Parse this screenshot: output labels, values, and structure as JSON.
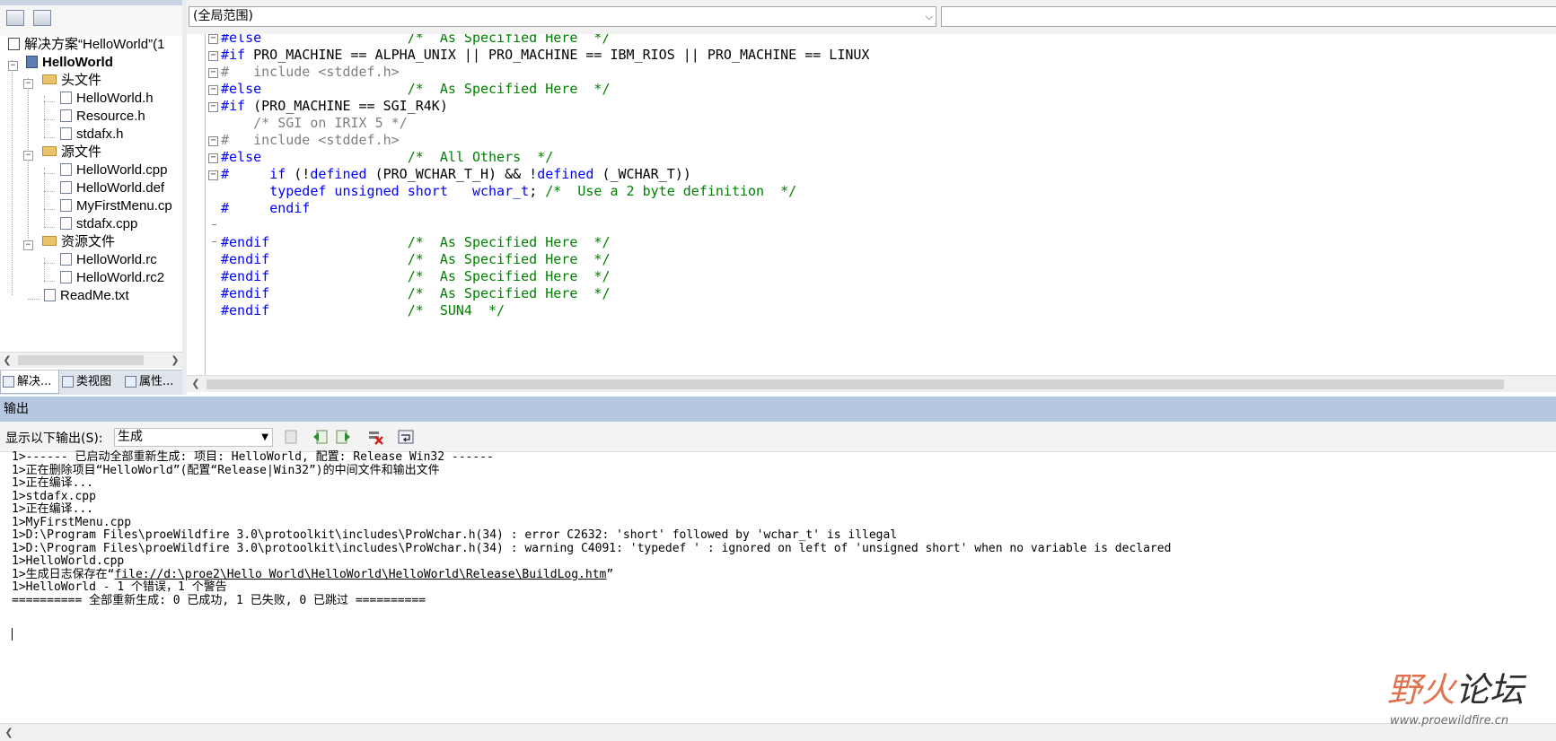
{
  "solution_explorer": {
    "tree": [
      {
        "label": "解决方案“HelloWorld”(1",
        "kind": "solution"
      },
      {
        "label": "HelloWorld",
        "kind": "project"
      },
      {
        "label": "头文件",
        "kind": "folder"
      },
      {
        "label": "HelloWorld.h",
        "kind": "header"
      },
      {
        "label": "Resource.h",
        "kind": "header"
      },
      {
        "label": "stdafx.h",
        "kind": "header"
      },
      {
        "label": "源文件",
        "kind": "folder"
      },
      {
        "label": "HelloWorld.cpp",
        "kind": "source"
      },
      {
        "label": "HelloWorld.def",
        "kind": "def"
      },
      {
        "label": "MyFirstMenu.cp",
        "kind": "source"
      },
      {
        "label": "stdafx.cpp",
        "kind": "source"
      },
      {
        "label": "资源文件",
        "kind": "folder"
      },
      {
        "label": "HelloWorld.rc",
        "kind": "resource"
      },
      {
        "label": "HelloWorld.rc2",
        "kind": "resource"
      },
      {
        "label": "ReadMe.txt",
        "kind": "text"
      }
    ],
    "tabs": [
      {
        "label": "解决...",
        "icon": "solution-icon"
      },
      {
        "label": "类视图",
        "icon": "class-view-icon"
      },
      {
        "label": "属性...",
        "icon": "properties-icon"
      }
    ]
  },
  "editor": {
    "scope": "(全局范围)",
    "lines": [
      {
        "seg": [
          {
            "t": "#else",
            "c": "kw"
          },
          {
            "t": "                  "
          },
          {
            "t": "/*  As Specified Here  */",
            "c": "cm"
          }
        ]
      },
      {
        "seg": [
          {
            "t": "#if",
            "c": "kw"
          },
          {
            "t": " PRO_MACHINE == ALPHA_UNIX || PRO_MACHINE == IBM_RIOS || PRO_MACHINE == LINUX"
          }
        ]
      },
      {
        "seg": [
          {
            "t": "#   include <stddef.h>",
            "c": "gr"
          }
        ]
      },
      {
        "seg": [
          {
            "t": "#else",
            "c": "kw"
          },
          {
            "t": "                  "
          },
          {
            "t": "/*  As Specified Here  */",
            "c": "cm"
          }
        ]
      },
      {
        "seg": [
          {
            "t": "#if",
            "c": "kw"
          },
          {
            "t": " (PRO_MACHINE == SGI_R4K)"
          }
        ]
      },
      {
        "seg": [
          {
            "t": "    /* SGI on IRIX 5 */",
            "c": "gr"
          }
        ]
      },
      {
        "seg": [
          {
            "t": "#   include <stddef.h>",
            "c": "gr"
          }
        ]
      },
      {
        "seg": [
          {
            "t": "#else",
            "c": "kw"
          },
          {
            "t": "                  "
          },
          {
            "t": "/*  All Others  */",
            "c": "cm"
          }
        ]
      },
      {
        "seg": [
          {
            "t": "#",
            "c": "kw"
          },
          {
            "t": "     "
          },
          {
            "t": "if",
            "c": "kw"
          },
          {
            "t": " (!"
          },
          {
            "t": "defined",
            "c": "kw"
          },
          {
            "t": " (PRO_WCHAR_T_H) && !"
          },
          {
            "t": "defined",
            "c": "kw"
          },
          {
            "t": " (_WCHAR_T))"
          }
        ]
      },
      {
        "seg": [
          {
            "t": "      "
          },
          {
            "t": "typedef unsigned short",
            "c": "kw"
          },
          {
            "t": "   "
          },
          {
            "t": "wchar_t",
            "c": "kw"
          },
          {
            "t": "; "
          },
          {
            "t": "/*  Use a 2 byte definition  */",
            "c": "cm"
          }
        ]
      },
      {
        "seg": [
          {
            "t": "#",
            "c": "kw"
          },
          {
            "t": "     "
          },
          {
            "t": "endif",
            "c": "kw"
          }
        ]
      },
      {
        "seg": []
      },
      {
        "seg": [
          {
            "t": "#endif",
            "c": "kw"
          },
          {
            "t": "                 "
          },
          {
            "t": "/*  As Specified Here  */",
            "c": "cm"
          }
        ]
      },
      {
        "seg": [
          {
            "t": "#endif",
            "c": "kw"
          },
          {
            "t": "                 "
          },
          {
            "t": "/*  As Specified Here  */",
            "c": "cm"
          }
        ]
      },
      {
        "seg": [
          {
            "t": "#endif",
            "c": "kw"
          },
          {
            "t": "                 "
          },
          {
            "t": "/*  As Specified Here  */",
            "c": "cm"
          }
        ]
      },
      {
        "seg": [
          {
            "t": "#endif",
            "c": "kw"
          },
          {
            "t": "                 "
          },
          {
            "t": "/*  As Specified Here  */",
            "c": "cm"
          }
        ]
      },
      {
        "seg": [
          {
            "t": "#endif",
            "c": "kw"
          },
          {
            "t": "                 "
          },
          {
            "t": "/*  SUN4  */",
            "c": "cm"
          }
        ]
      }
    ]
  },
  "output": {
    "title": "输出",
    "source_label": "显示以下输出(S):",
    "source_value": "生成",
    "lines": [
      "1>------ 已启动全部重新生成: 项目: HelloWorld, 配置: Release Win32 ------",
      "1>正在删除项目“HelloWorld”(配置“Release|Win32”)的中间文件和输出文件",
      "1>正在编译...",
      "1>stdafx.cpp",
      "1>正在编译...",
      "1>MyFirstMenu.cpp",
      "1>D:\\Program Files\\proeWildfire 3.0\\protoolkit\\includes\\ProWchar.h(34) : error C2632: 'short' followed by 'wchar_t' is illegal",
      "1>D:\\Program Files\\proeWildfire 3.0\\protoolkit\\includes\\ProWchar.h(34) : warning C4091: 'typedef ' : ignored on left of 'unsigned short' when no variable is declared",
      "1>HelloWorld.cpp",
      "1>生成日志保存在“file://d:\\proe2\\Hello World\\HelloWorld\\HelloWorld\\Release\\BuildLog.htm”",
      "1>HelloWorld - 1 个错误，1 个警告",
      "========== 全部重新生成: 0 已成功, 1 已失败, 0 已跳过 =========="
    ],
    "log_link": "file://d:\\proe2\\Hello World\\HelloWorld\\HelloWorld\\Release\\BuildLog.htm"
  },
  "watermark": {
    "brand_accent": "野火",
    "brand_rest": "论坛",
    "url": "www.proewildfire.cn"
  },
  "colors": {
    "keyword": "#0000ff",
    "comment": "#008000",
    "inactive": "#808080",
    "output_header": "#b6c8df",
    "watermark_accent": "#e0724f"
  }
}
